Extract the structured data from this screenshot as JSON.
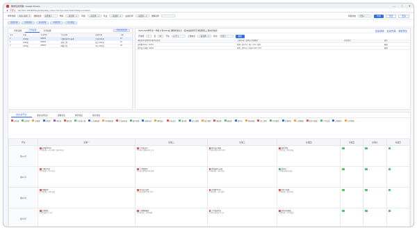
{
  "window": {
    "title": "教学任务管理 - Google Chrome",
    "controls": [
      "—",
      "□",
      "✕"
    ],
    "not_secure": "不安全",
    "url": "192.168.1.186:8080/jwglxt/kbgl/kbgl_cxKbxx.html?gnmkdm=N21076&layout=default"
  },
  "filters": {
    "items": [
      {
        "label": "学年学期",
        "value": "2024-2025 - 1"
      },
      {
        "label": "课程性质",
        "value": "必修课 ▾"
      },
      {
        "label": "学院",
        "value": "—请选择— ▾"
      },
      {
        "label": "年级",
        "value": "—请选择— ▾"
      },
      {
        "label": "专业",
        "value": "—请选择— ▾"
      },
      {
        "label": "班级名称",
        "value": "—请选择— ▾"
      },
      {
        "label": "课程名称",
        "value": ""
      }
    ],
    "extra_label": "排课状态",
    "extra_value": "全部 ▾",
    "search": "查询",
    "reset": "重置",
    "more": "更多"
  },
  "actions": [
    "批量排课",
    "智能排课",
    "自动排课",
    "冲突检测",
    "导出课表"
  ],
  "left_panel": {
    "tabs": [
      "待排班级",
      "已排班级",
      "全部班级"
    ],
    "active_tab": 1,
    "action_label": "查看排课结果",
    "headers": [
      "序号",
      "年级",
      "专业代码",
      "专业名称",
      "班级名称",
      "人数"
    ],
    "rows": [
      [
        "1",
        "2024级",
        "080901",
        "计算机科学与技术",
        "计科2401班",
        "45"
      ],
      [
        "2",
        "2024级",
        "080902",
        "软件工程",
        "软工2401班",
        "42"
      ],
      [
        "3",
        "2024级",
        "080903",
        "网络工程",
        "网工2401班",
        "38"
      ]
    ]
  },
  "right_panel": {
    "title": "2024-2025学年第一学期 计科2401班 课程排课信息（选中班级所有已排课程及上课时间地点）",
    "links": [
      "批量调课",
      "批量停课",
      "课表预览"
    ],
    "filter_labels": [
      "开课周",
      "至",
      "节次",
      "上课地点",
      "周次"
    ],
    "filter_values": [
      "1",
      "18",
      "1-2节 ▾",
      "—请选择— ▾",
      "全部 ▾"
    ],
    "filter_button": "确定",
    "headers": [
      "课程名称/课程代码/教学班名称",
      "上课时间/上课地点/任课教师",
      "合班情况",
      "操作"
    ],
    "rows": [
      [
        "高等数学A(1) / 10101",
        "星期一第1-2节 / 教一-101 / 张明",
        "",
        "编辑"
      ],
      [
        "程序设计基础 / 10203",
        "星期三第3-4节 / 机房A-203 / 李华",
        "",
        "编辑"
      ]
    ]
  },
  "bottom": {
    "tabs": [
      "课表(按节次)",
      "课表(按周次)",
      "课程列表",
      "教师课表",
      "教室课表"
    ],
    "active_tab": 0,
    "legend": [
      {
        "label": "必修课",
        "color": "#e8574b"
      },
      {
        "label": "选修课",
        "color": "#4fc26b"
      },
      {
        "label": "实践课",
        "color": "#f2a33a"
      },
      {
        "label": "实验课",
        "color": "#2f6fe0"
      },
      {
        "label": "体育课",
        "color": "#9b59b6"
      },
      {
        "label": "通识课",
        "color": "#e8574b"
      },
      {
        "label": "专业核心课",
        "color": "#4fc26b"
      },
      {
        "label": "公共基础课",
        "color": "#2f6fe0"
      },
      {
        "label": "学科基础课",
        "color": "#f2a33a"
      },
      {
        "label": "专业选修课",
        "color": "#e8574b"
      },
      {
        "label": "集中实践",
        "color": "#4fc26b"
      },
      {
        "label": "创新创业",
        "color": "#2f6fe0"
      },
      {
        "label": "课程设计",
        "color": "#f2a33a"
      },
      {
        "label": "毕业设计",
        "color": "#e8574b"
      },
      {
        "label": "理论课",
        "color": "#4fc26b"
      },
      {
        "label": "线上课程",
        "color": "#2f6fe0"
      },
      {
        "label": "混合课程",
        "color": "#f2a33a"
      },
      {
        "label": "重修课",
        "color": "#e8574b"
      },
      {
        "label": "辅修课",
        "color": "#4fc26b"
      },
      {
        "label": "双学位",
        "color": "#2f6fe0"
      },
      {
        "label": "素质拓展",
        "color": "#f2a33a"
      },
      {
        "label": "第二课堂",
        "color": "#e8574b"
      },
      {
        "label": "劳动教育",
        "color": "#4fc26b"
      },
      {
        "label": "军事理论",
        "color": "#2f6fe0"
      },
      {
        "label": "心理健康",
        "color": "#f2a33a"
      },
      {
        "label": "形势与政策",
        "color": "#e8574b"
      },
      {
        "label": "大学英语",
        "color": "#4fc26b"
      },
      {
        "label": "高等数学",
        "color": "#2f6fe0"
      },
      {
        "label": "大学物理",
        "color": "#f2a33a"
      }
    ],
    "columns": [
      "节次",
      "星期一",
      "星期二",
      "星期三",
      "星期四",
      "星期五",
      "星期六",
      "星期日"
    ],
    "periods": [
      "第1-2节",
      "第3-4节",
      "第5-6节",
      "第7-8节"
    ],
    "cells": [
      [
        {
          "t": "高等数学A(1)",
          "s": "1-16周 教一-101 张明 计科2401班",
          "c": "#e8574b"
        },
        {
          "t": "大学英语(1)",
          "s": "1-16周 外语楼-201 王芳",
          "c": "#e8574b"
        },
        {
          "t": "程序设计基础",
          "s": "1-16周 机房A-203 李华",
          "c": "#e8574b"
        },
        {
          "t": "线性代数",
          "s": "1-8周 教二-305 赵强",
          "c": "#e8574b"
        },
        {
          "t": "",
          "s": "",
          "c": "#4fc26b"
        },
        {
          "t": "",
          "s": "",
          "c": "#4fc26b"
        },
        {
          "t": "",
          "s": "",
          "c": "#4fc26b"
        }
      ],
      [
        {
          "t": "计算机导论",
          "s": "1-12周 教一-204 刘洋",
          "c": "#e8574b"
        },
        {
          "t": "大学物理(1)",
          "s": "1-16周 理学楼-102 陈刚",
          "c": "#e8574b"
        },
        {
          "t": "思想道德与法治",
          "s": "1-16周 教三-401 孙丽",
          "c": "#e8574b"
        },
        {
          "t": "体育(1)",
          "s": "1-16周 体育馆 周杰",
          "c": "#4fc26b"
        },
        {
          "t": "",
          "s": "",
          "c": "#4fc26b"
        },
        {
          "t": "",
          "s": "",
          "c": "#4fc26b"
        },
        {
          "t": "",
          "s": "",
          "c": "#4fc26b"
        }
      ],
      [
        {
          "t": "离散数学",
          "s": "1-16周 教二-108 吴敏",
          "c": "#e8574b"
        },
        {
          "t": "程序设计实验",
          "s": "2-16周 机房B-105 李华",
          "c": "#e8574b"
        },
        {
          "t": "高等数学A(1)",
          "s": "1-16周 教一-101 张明",
          "c": "#e8574b"
        },
        {
          "t": "形势与政策",
          "s": "5-8周 教三-201 郑伟",
          "c": "#e8574b"
        },
        {
          "t": "",
          "s": "",
          "c": "#4fc26b"
        },
        {
          "t": "",
          "s": "",
          "c": "#4fc26b"
        },
        {
          "t": "",
          "s": "",
          "c": "#4fc26b"
        }
      ],
      [
        {
          "t": "军事理论",
          "s": "1-8周 报告厅 马军",
          "c": "#e8574b"
        },
        {
          "t": "心理健康教育",
          "s": "9-16周 教三-105 林静",
          "c": "#e8574b"
        },
        {
          "t": "大学英语听说",
          "s": "1-16周 语音室-3 王芳",
          "c": "#e8574b"
        },
        {
          "t": "创新创业基础",
          "s": "1-8周 教一-301 黄磊",
          "c": "#e8574b"
        },
        {
          "t": "",
          "s": "",
          "c": "#4fc26b"
        },
        {
          "t": "",
          "s": "",
          "c": "#4fc26b"
        },
        {
          "t": "",
          "s": "",
          "c": "#4fc26b"
        }
      ]
    ]
  },
  "colors": {
    "accent": "#2f6fe0",
    "danger": "#e8574b",
    "success": "#4fc26b"
  }
}
